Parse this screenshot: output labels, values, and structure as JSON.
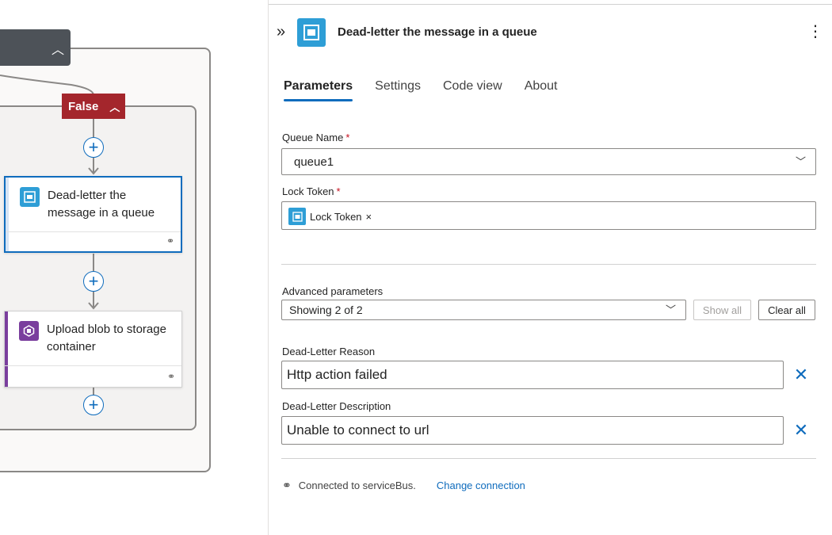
{
  "canvas": {
    "condition_branch_label": "False",
    "actions": [
      {
        "title": "Dead-letter the message in a queue",
        "icon": "service-bus-queue-icon",
        "accent": "#2e9ed6",
        "selected": true
      },
      {
        "title": "Upload blob to storage container",
        "icon": "storage-blob-icon",
        "accent": "#7a3e9d",
        "selected": false
      }
    ]
  },
  "panel": {
    "title": "Dead-letter the message in a queue",
    "tabs": [
      {
        "label": "Parameters",
        "active": true
      },
      {
        "label": "Settings",
        "active": false
      },
      {
        "label": "Code view",
        "active": false
      },
      {
        "label": "About",
        "active": false
      }
    ],
    "queue_name": {
      "label": "Queue Name",
      "required_mark": "*",
      "value": "queue1"
    },
    "lock_token": {
      "label": "Lock Token",
      "required_mark": "*",
      "token_label": "Lock Token",
      "token_remove": "×"
    },
    "advanced": {
      "label": "Advanced parameters",
      "value": "Showing 2 of 2",
      "show_all": "Show all",
      "clear_all": "Clear all"
    },
    "dead_letter_reason": {
      "label": "Dead-Letter Reason",
      "value": "Http action failed"
    },
    "dead_letter_description": {
      "label": "Dead-Letter Description",
      "value": "Unable to connect to url"
    },
    "connection": {
      "text": "Connected to serviceBus.",
      "change_link": "Change connection"
    }
  },
  "colors": {
    "accent_blue": "#0f6cbd",
    "false_badge": "#a4262c",
    "service_bus": "#2e9ed6",
    "storage": "#7a3e9d",
    "required": "#c50f1f"
  }
}
